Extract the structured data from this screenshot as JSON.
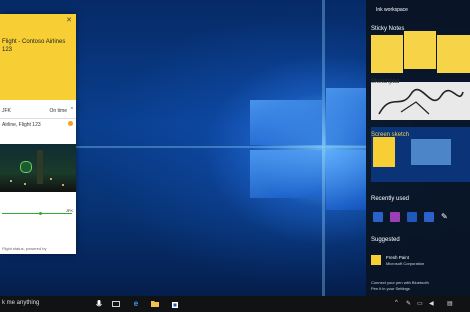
{
  "flight_card": {
    "title": "Flight - Contoso Airlines 123",
    "close_glyph": "✕",
    "origin_code": "JFK",
    "status": "On time",
    "flight_label": "Airline, Flight 123",
    "arrive_code": "JFK",
    "footer": "Flight status, powered by"
  },
  "ink_workspace": {
    "title": "Ink workspace",
    "sticky_notes_label": "Sticky Notes",
    "sketchpad_label": "Sketchpad",
    "screen_sketch_label": "Screen sketch",
    "recently_used_label": "Recently used",
    "suggested_label": "Suggested",
    "suggested_app_name": "Fresh Paint",
    "suggested_app_publisher": "Microsoft Corporation",
    "footer_line1": "Connect your pen with Bluetooth",
    "footer_line2": "Pen it in your Settings",
    "recent_colors": [
      "#2a62c9",
      "#9b3fb5",
      "#1f58b8",
      "#2a62c9",
      "#ffffff"
    ]
  },
  "taskbar": {
    "search_text": "k me anything",
    "mic_icon": "microphone-icon",
    "task_view_icon": "task-view-icon",
    "edge_icon": "edge-icon",
    "explorer_icon": "file-explorer-icon",
    "store_icon": "store-icon"
  }
}
